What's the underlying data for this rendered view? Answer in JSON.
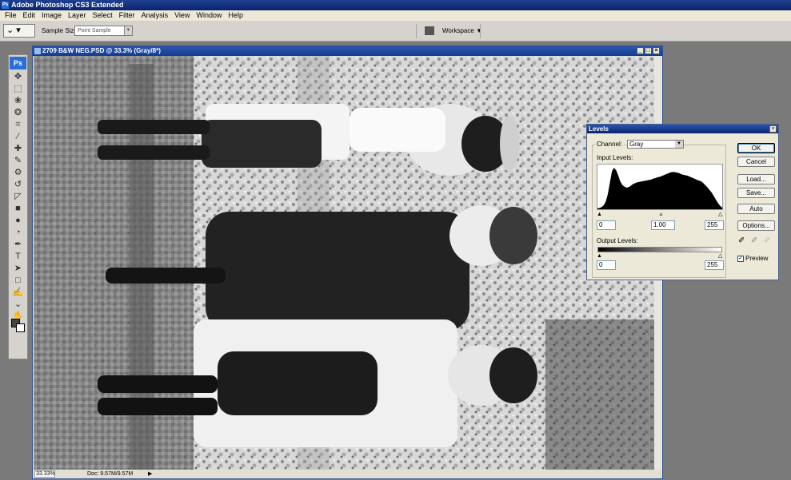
{
  "app": {
    "title": "Adobe Photoshop CS3 Extended",
    "logo": "Ps"
  },
  "menu": [
    "File",
    "Edit",
    "Image",
    "Layer",
    "Select",
    "Filter",
    "Analysis",
    "View",
    "Window",
    "Help"
  ],
  "options_bar": {
    "tool_icon": "eyedropper-icon",
    "sample_size_label": "Sample Size:",
    "sample_size_value": "Point Sample",
    "workspace_label": "Workspace ▼"
  },
  "toolbox": {
    "tools": [
      "move-icon",
      "marquee-icon",
      "lasso-icon",
      "quick-select-icon",
      "crop-icon",
      "slice-icon",
      "healing-icon",
      "brush-icon",
      "clone-stamp-icon",
      "history-brush-icon",
      "eraser-icon",
      "gradient-icon",
      "blur-icon",
      "dodge-icon",
      "pen-icon",
      "type-icon",
      "path-select-icon",
      "shape-icon",
      "notes-icon",
      "eyedropper-icon",
      "hand-icon",
      "zoom-icon"
    ],
    "glyphs": [
      "✥",
      "⬚",
      "❀",
      "❂",
      "⌗",
      "∕",
      "✚",
      "✎",
      "⚙",
      "↺",
      "◸",
      "■",
      "●",
      "◔",
      "✒",
      "T",
      "➤",
      "□",
      "✍",
      "⌄",
      "✋",
      "⚲"
    ]
  },
  "document": {
    "title": "2709 B&W NEG.PSD @ 33.3% (Gray/8*)",
    "zoom": "33.33%",
    "doc_size": "Doc: 9.57M/9.57M",
    "window_buttons": [
      "_",
      "□",
      "×"
    ]
  },
  "levels": {
    "title": "Levels",
    "close": "×",
    "channel_label": "Channel:",
    "channel_value": "Gray",
    "input_levels_label": "Input Levels:",
    "input_black": "0",
    "input_gamma": "1.00",
    "input_white": "255",
    "output_levels_label": "Output Levels:",
    "output_black": "0",
    "output_white": "255",
    "buttons": {
      "ok": "OK",
      "cancel": "Cancel",
      "load": "Load...",
      "save": "Save...",
      "auto": "Auto",
      "options": "Options..."
    },
    "preview_label": "Preview",
    "preview_checked": true,
    "histogram": [
      2,
      3,
      5,
      9,
      18,
      35,
      62,
      88,
      96,
      90,
      78,
      64,
      56,
      52,
      50,
      51,
      54,
      58,
      60,
      62,
      63,
      64,
      65,
      66,
      67,
      68,
      69,
      71,
      72,
      74,
      75,
      77,
      79,
      81,
      83,
      85,
      86,
      86,
      85,
      84,
      82,
      80,
      79,
      78,
      76,
      74,
      72,
      70,
      68,
      66,
      64,
      60,
      55,
      50,
      44,
      38,
      30,
      22,
      14,
      8,
      4
    ]
  }
}
